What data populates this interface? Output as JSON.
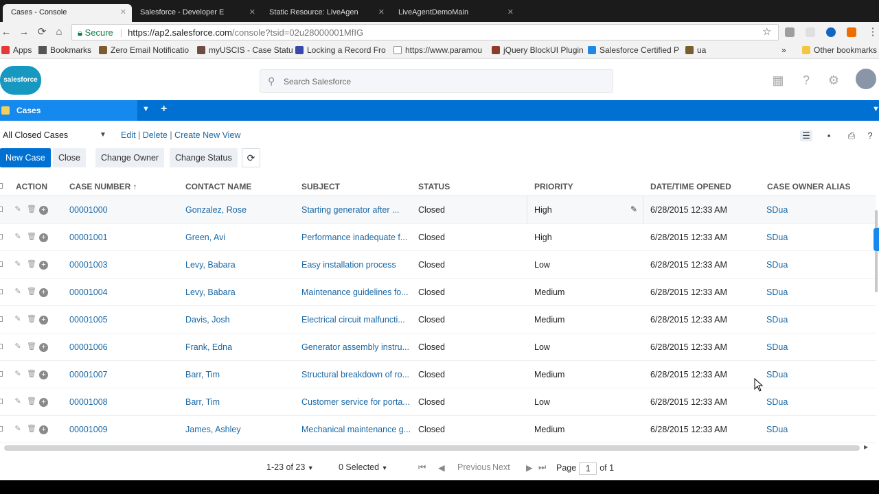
{
  "browser": {
    "tabs": [
      {
        "title": "Cases - Console"
      },
      {
        "title": "Salesforce - Developer E"
      },
      {
        "title": "Static Resource: LiveAgen"
      },
      {
        "title": "LiveAgentDemoMain"
      }
    ],
    "secure_label": "Secure",
    "url_host": "https://ap2.salesforce.com",
    "url_path": "/console?tsid=02u28000001MfIG",
    "bookmarks": [
      {
        "label": "Apps"
      },
      {
        "label": "Bookmarks"
      },
      {
        "label": "Zero Email Notificatio"
      },
      {
        "label": "myUSCIS - Case Statu"
      },
      {
        "label": "Locking a Record Fro"
      },
      {
        "label": "https://www.paramou"
      },
      {
        "label": "jQuery BlockUI Plugin"
      },
      {
        "label": "Salesforce Certified P"
      },
      {
        "label": "ua"
      }
    ],
    "other_bookmarks": "Other bookmarks"
  },
  "header": {
    "logo_text": "salesforce",
    "search_placeholder": "Search Salesforce"
  },
  "console_tab": {
    "label": "Cases"
  },
  "list_view": {
    "selected": "All Closed Cases",
    "edit": "Edit",
    "delete": "Delete",
    "create": "Create New View"
  },
  "toolbar": {
    "new_case": "New Case",
    "close": "Close",
    "change_owner": "Change Owner",
    "change_status": "Change Status"
  },
  "columns": {
    "action": "ACTION",
    "case_number": "CASE NUMBER ↑",
    "contact_name": "CONTACT NAME",
    "subject": "SUBJECT",
    "status": "STATUS",
    "priority": "PRIORITY",
    "opened": "DATE/TIME OPENED",
    "owner": "CASE OWNER ALIAS"
  },
  "rows": [
    {
      "case": "00001000",
      "contact": "Gonzalez, Rose",
      "subject": "Starting generator after ...",
      "status": "Closed",
      "priority": "High",
      "opened": "6/28/2015 12:33 AM",
      "owner": "SDua"
    },
    {
      "case": "00001001",
      "contact": "Green, Avi",
      "subject": "Performance inadequate f...",
      "status": "Closed",
      "priority": "High",
      "opened": "6/28/2015 12:33 AM",
      "owner": "SDua"
    },
    {
      "case": "00001003",
      "contact": "Levy, Babara",
      "subject": "Easy installation process",
      "status": "Closed",
      "priority": "Low",
      "opened": "6/28/2015 12:33 AM",
      "owner": "SDua"
    },
    {
      "case": "00001004",
      "contact": "Levy, Babara",
      "subject": "Maintenance guidelines fo...",
      "status": "Closed",
      "priority": "Medium",
      "opened": "6/28/2015 12:33 AM",
      "owner": "SDua"
    },
    {
      "case": "00001005",
      "contact": "Davis, Josh",
      "subject": "Electrical circuit malfuncti...",
      "status": "Closed",
      "priority": "Medium",
      "opened": "6/28/2015 12:33 AM",
      "owner": "SDua"
    },
    {
      "case": "00001006",
      "contact": "Frank, Edna",
      "subject": "Generator assembly instru...",
      "status": "Closed",
      "priority": "Low",
      "opened": "6/28/2015 12:33 AM",
      "owner": "SDua"
    },
    {
      "case": "00001007",
      "contact": "Barr, Tim",
      "subject": "Structural breakdown of ro...",
      "status": "Closed",
      "priority": "Medium",
      "opened": "6/28/2015 12:33 AM",
      "owner": "SDua"
    },
    {
      "case": "00001008",
      "contact": "Barr, Tim",
      "subject": "Customer service for porta...",
      "status": "Closed",
      "priority": "Low",
      "opened": "6/28/2015 12:33 AM",
      "owner": "SDua"
    },
    {
      "case": "00001009",
      "contact": "James, Ashley",
      "subject": "Mechanical maintenance g...",
      "status": "Closed",
      "priority": "Medium",
      "opened": "6/28/2015 12:33 AM",
      "owner": "SDua"
    }
  ],
  "footer": {
    "range": "1-23 of 23",
    "selected": "0 Selected",
    "previous": "Previous",
    "next": "Next",
    "page_label": "Page",
    "page_value": "1",
    "of_label": "of 1"
  },
  "colors": {
    "brand_blue": "#0070d2",
    "tab_blue": "#1589ee",
    "link": "#1968a6"
  },
  "icons": [
    "back-icon",
    "forward-icon",
    "loading-icon",
    "home-icon",
    "lock-icon",
    "star-icon",
    "search-icon",
    "app-launcher-icon",
    "help-icon",
    "gear-icon",
    "avatar-icon",
    "edit-icon",
    "delete-icon",
    "plus-icon",
    "refresh-icon",
    "list-view-icon",
    "chat-icon",
    "print-icon",
    "first-page-icon",
    "prev-page-icon",
    "next-page-icon",
    "last-page-icon"
  ]
}
